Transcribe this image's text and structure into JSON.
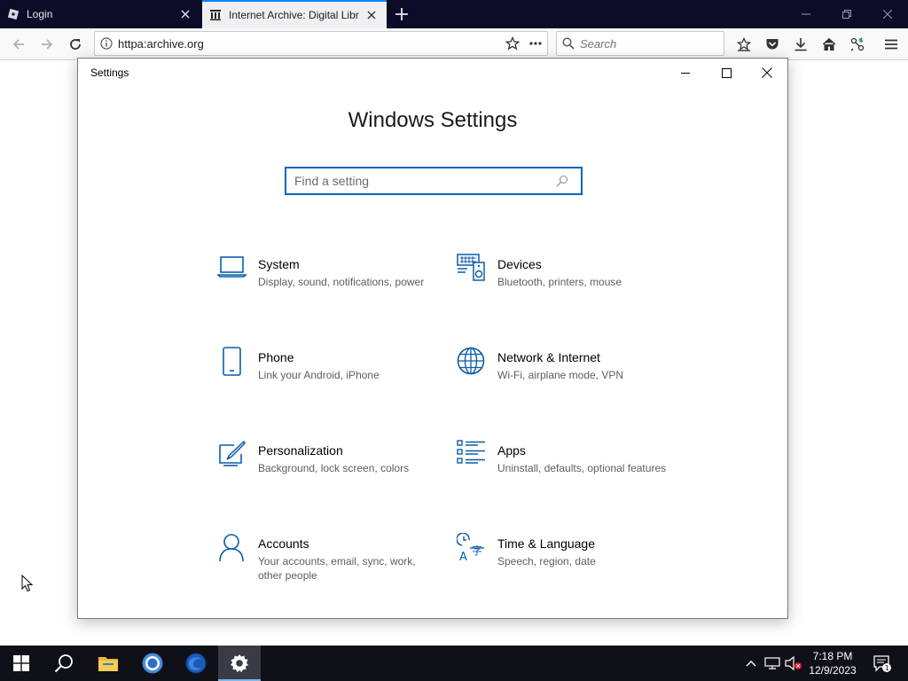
{
  "browser": {
    "tabs": [
      {
        "title": "Login",
        "icon": "roblox-icon",
        "active": false
      },
      {
        "title": "Internet Archive: Digital Libr",
        "icon": "archive-icon",
        "active": true
      }
    ],
    "url": "httpa:archive.org",
    "search_placeholder": "Search"
  },
  "settings_window": {
    "title": "Settings",
    "heading": "Windows Settings",
    "search_placeholder": "Find a setting",
    "categories": [
      {
        "name": "System",
        "desc": "Display, sound, notifications, power",
        "icon": "laptop-icon"
      },
      {
        "name": "Devices",
        "desc": "Bluetooth, printers, mouse",
        "icon": "devices-icon"
      },
      {
        "name": "Phone",
        "desc": "Link your Android, iPhone",
        "icon": "phone-icon"
      },
      {
        "name": "Network & Internet",
        "desc": "Wi-Fi, airplane mode, VPN",
        "icon": "globe-icon"
      },
      {
        "name": "Personalization",
        "desc": "Background, lock screen, colors",
        "icon": "paint-icon"
      },
      {
        "name": "Apps",
        "desc": "Uninstall, defaults, optional features",
        "icon": "apps-list-icon"
      },
      {
        "name": "Accounts",
        "desc": "Your accounts, email, sync, work, other people",
        "icon": "person-icon"
      },
      {
        "name": "Time & Language",
        "desc": "Speech, region, date",
        "icon": "time-language-icon"
      }
    ]
  },
  "taskbar": {
    "time": "7:18 PM",
    "date": "12/9/2023",
    "notification_count": "1"
  },
  "colors": {
    "accent": "#0067b8",
    "icon_blue": "#0a5ea8",
    "tabbar_bg": "#0c0c28",
    "taskbar_bg": "#101018"
  }
}
